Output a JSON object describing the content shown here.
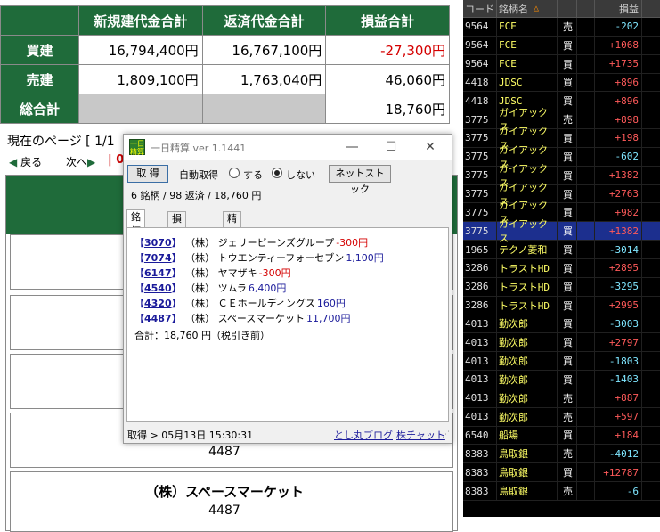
{
  "summary": {
    "headers": [
      "新規建代金合計",
      "返済代金合計",
      "損益合計"
    ],
    "rows": [
      {
        "label": "買建",
        "new": "16,794,400円",
        "close": "16,767,100円",
        "pl": "-27,300円"
      },
      {
        "label": "売建",
        "new": "1,809,100円",
        "close": "1,763,040円",
        "pl": "46,060円"
      },
      {
        "label": "総合計",
        "new": "",
        "close": "",
        "pl": "18,760円"
      }
    ]
  },
  "pager": {
    "current": "現在のページ [ 1/1",
    "prev": "戻る",
    "next": "次へ",
    "sep": "0"
  },
  "detail": {
    "code_a": "4487",
    "name_b": "（株）スペースマーケット",
    "code_b": "4487"
  },
  "app": {
    "title": "一日精算 ver 1.1441",
    "icon_text": "一日 精算",
    "fetch_btn": "取 得",
    "auto_label": "自動取得",
    "radio_on": "する",
    "radio_off": "しない",
    "net_btn": "ネットストック",
    "counts": "6 銘柄 / 98 返済 / 18,760 円",
    "tabs": [
      "銘柄別",
      "損益推移",
      "精算表"
    ],
    "trades": [
      {
        "code": "3070",
        "name": "（株） ジェリービーンズグループ",
        "amount": "-300円",
        "sign": "neg"
      },
      {
        "code": "7074",
        "name": "（株） トウエンティーフォーセブン",
        "amount": "1,100円",
        "sign": "pos"
      },
      {
        "code": "6147",
        "name": "（株） ヤマザキ",
        "amount": "-300円",
        "sign": "neg"
      },
      {
        "code": "4540",
        "name": "（株） ツムラ",
        "amount": "6,400円",
        "sign": "pos"
      },
      {
        "code": "4320",
        "name": "（株） ＣＥホールディングス",
        "amount": "160円",
        "sign": "pos"
      },
      {
        "code": "4487",
        "name": "（株） スペースマーケット",
        "amount": "11,700円",
        "sign": "pos"
      }
    ],
    "total": "合計：18,760 円（税引き前）",
    "status": "取得 > 05月13日 15:30:31",
    "link_blog": "とし丸ブログ",
    "link_chart": "株チャット"
  },
  "stock_list": {
    "headers": {
      "code": "コード",
      "name": "銘柄名",
      "pl": "損益"
    },
    "rows": [
      {
        "code": "9564",
        "name": "FCE",
        "side": "売",
        "pl": "-202",
        "sign": "neg"
      },
      {
        "code": "9564",
        "name": "FCE",
        "side": "買",
        "pl": "+1068",
        "sign": "pos"
      },
      {
        "code": "9564",
        "name": "FCE",
        "side": "買",
        "pl": "+1735",
        "sign": "pos"
      },
      {
        "code": "4418",
        "name": "JDSC",
        "side": "買",
        "pl": "+896",
        "sign": "pos"
      },
      {
        "code": "4418",
        "name": "JDSC",
        "side": "買",
        "pl": "+896",
        "sign": "pos"
      },
      {
        "code": "3775",
        "name": "ガイアックス",
        "side": "売",
        "pl": "+898",
        "sign": "pos"
      },
      {
        "code": "3775",
        "name": "ガイアックス",
        "side": "買",
        "pl": "+198",
        "sign": "pos"
      },
      {
        "code": "3775",
        "name": "ガイアックス",
        "side": "買",
        "pl": "-602",
        "sign": "neg"
      },
      {
        "code": "3775",
        "name": "ガイアックス",
        "side": "買",
        "pl": "+1382",
        "sign": "pos"
      },
      {
        "code": "3775",
        "name": "ガイアックス",
        "side": "買",
        "pl": "+2763",
        "sign": "pos"
      },
      {
        "code": "3775",
        "name": "ガイアックス",
        "side": "買",
        "pl": "+982",
        "sign": "pos"
      },
      {
        "code": "3775",
        "name": "ガイアックス",
        "side": "買",
        "pl": "+1382",
        "sign": "pos",
        "selected": true
      },
      {
        "code": "1965",
        "name": "テクノ菱和",
        "side": "買",
        "pl": "-3014",
        "sign": "neg"
      },
      {
        "code": "3286",
        "name": "トラストHD",
        "side": "買",
        "pl": "+2895",
        "sign": "pos"
      },
      {
        "code": "3286",
        "name": "トラストHD",
        "side": "買",
        "pl": "-3295",
        "sign": "neg"
      },
      {
        "code": "3286",
        "name": "トラストHD",
        "side": "買",
        "pl": "+2995",
        "sign": "pos"
      },
      {
        "code": "4013",
        "name": "勤次郎",
        "side": "買",
        "pl": "-3003",
        "sign": "neg"
      },
      {
        "code": "4013",
        "name": "勤次郎",
        "side": "買",
        "pl": "+2797",
        "sign": "pos"
      },
      {
        "code": "4013",
        "name": "勤次郎",
        "side": "買",
        "pl": "-1803",
        "sign": "neg"
      },
      {
        "code": "4013",
        "name": "勤次郎",
        "side": "買",
        "pl": "-1403",
        "sign": "neg"
      },
      {
        "code": "4013",
        "name": "勤次郎",
        "side": "売",
        "pl": "+887",
        "sign": "pos"
      },
      {
        "code": "4013",
        "name": "勤次郎",
        "side": "売",
        "pl": "+597",
        "sign": "pos"
      },
      {
        "code": "6540",
        "name": "船場",
        "side": "買",
        "pl": "+184",
        "sign": "pos"
      },
      {
        "code": "8383",
        "name": "鳥取銀",
        "side": "売",
        "pl": "-4012",
        "sign": "neg"
      },
      {
        "code": "8383",
        "name": "鳥取銀",
        "side": "買",
        "pl": "+12787",
        "sign": "pos"
      },
      {
        "code": "8383",
        "name": "鳥取銀",
        "side": "売",
        "pl": "-6",
        "sign": "neg"
      }
    ]
  },
  "colors": {
    "header_green": "#1f6b3a",
    "negative": "#d40000",
    "link": "#1a1a9a",
    "selected_row": "#1c2f8e"
  }
}
